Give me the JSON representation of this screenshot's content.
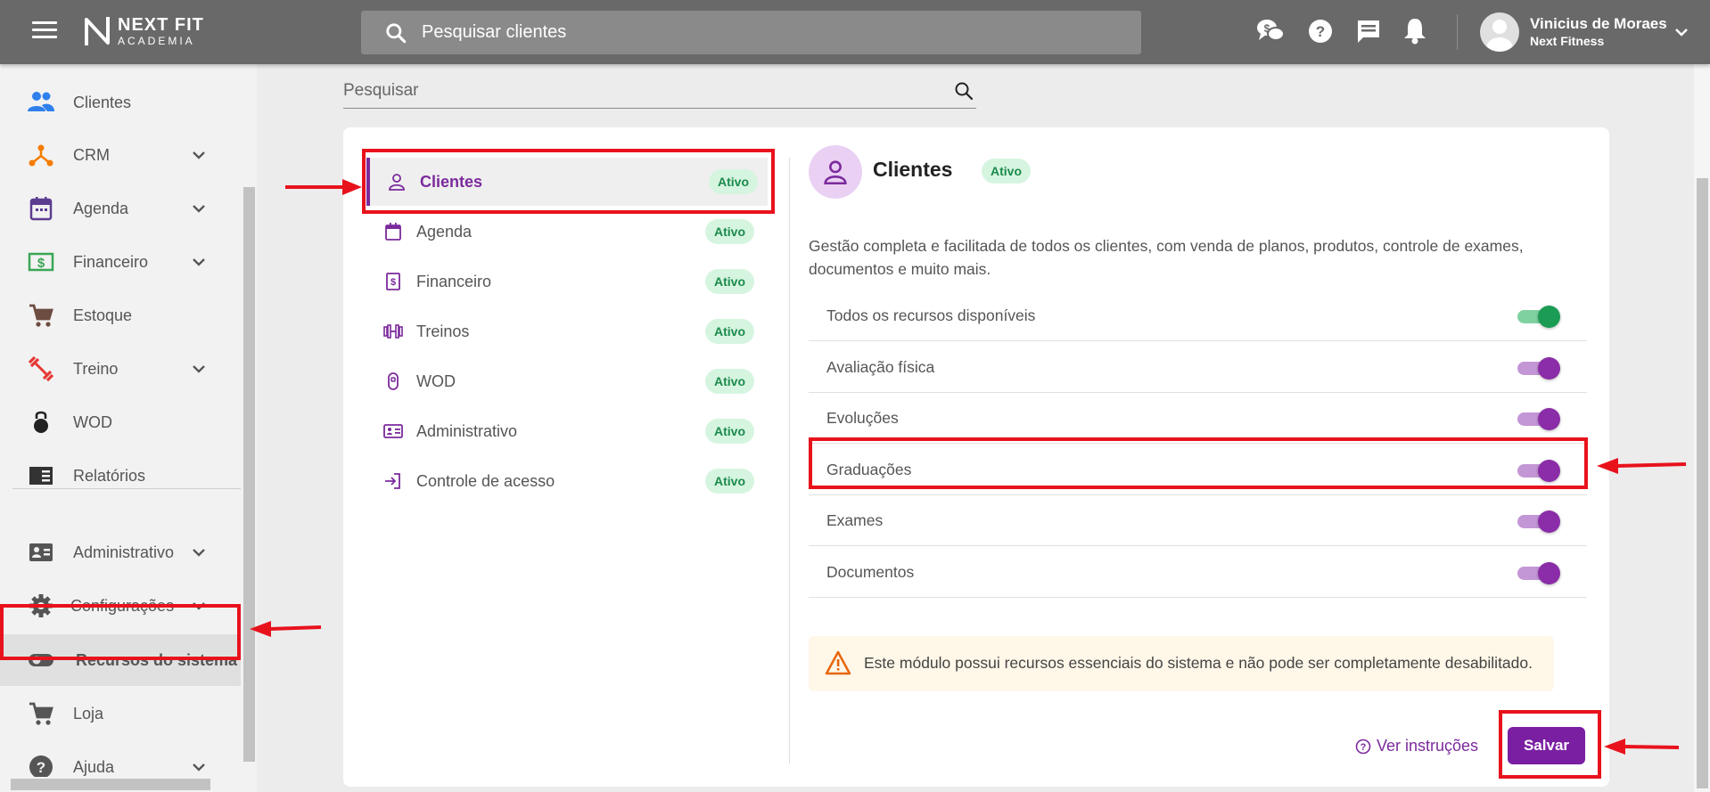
{
  "topbar": {
    "logo_line1": "NEXT FIT",
    "logo_line2": "ACADEMIA",
    "search_placeholder": "Pesquisar clientes",
    "icons": [
      "chat-dollar-icon",
      "help-icon",
      "message-icon",
      "bell-icon"
    ],
    "user_name": "Vinicius de Moraes",
    "user_org": "Next Fitness"
  },
  "sidebar": {
    "items": [
      {
        "label": "Clientes",
        "icon": "people-icon",
        "color": "#2f80ed"
      },
      {
        "label": "CRM",
        "icon": "crm-icon",
        "color": "#f57c00"
      },
      {
        "label": "Agenda",
        "icon": "calendar-icon",
        "color": "#5c3d8f"
      },
      {
        "label": "Financeiro",
        "icon": "money-icon",
        "color": "#3aa655"
      },
      {
        "label": "Estoque",
        "icon": "cart-icon",
        "color": "#6d4c41"
      },
      {
        "label": "Treino",
        "icon": "dumbbell-icon",
        "color": "#e53935"
      },
      {
        "label": "WOD",
        "icon": "kettlebell-icon",
        "color": "#222222"
      },
      {
        "label": "Relatórios",
        "icon": "report-icon",
        "color": "#333333"
      },
      {
        "label": "Administrativo",
        "icon": "id-card-icon",
        "color": "#555555"
      },
      {
        "label": "Configurações",
        "icon": "gear-icon",
        "color": "#555555"
      },
      {
        "label": "Recursos do sistema",
        "icon": "toggle-icon",
        "color": "#555555"
      },
      {
        "label": "Loja",
        "icon": "cart-icon",
        "color": "#555555"
      },
      {
        "label": "Ajuda",
        "icon": "help-icon",
        "color": "#555555"
      }
    ]
  },
  "filter": {
    "placeholder": "Pesquisar"
  },
  "modules": [
    {
      "label": "Clientes",
      "status": "Ativo",
      "icon": "person-icon"
    },
    {
      "label": "Agenda",
      "status": "Ativo",
      "icon": "calendar-icon"
    },
    {
      "label": "Financeiro",
      "status": "Ativo",
      "icon": "money-icon"
    },
    {
      "label": "Treinos",
      "status": "Ativo",
      "icon": "dumbbell-icon"
    },
    {
      "label": "WOD",
      "status": "Ativo",
      "icon": "kettlebell-icon"
    },
    {
      "label": "Administrativo",
      "status": "Ativo",
      "icon": "id-card-icon"
    },
    {
      "label": "Controle de acesso",
      "status": "Ativo",
      "icon": "login-icon"
    }
  ],
  "detail": {
    "title": "Clientes",
    "status": "Ativo",
    "description": "Gestão completa e facilitada de todos os clientes, com venda de planos, produtos, controle de exames, documentos e muito mais.",
    "features": [
      {
        "label": "Todos os recursos disponíveis",
        "on": true,
        "color": "green"
      },
      {
        "label": "Avaliação física",
        "on": true,
        "color": "purple"
      },
      {
        "label": "Evoluções",
        "on": true,
        "color": "purple"
      },
      {
        "label": "Graduações",
        "on": true,
        "color": "purple"
      },
      {
        "label": "Exames",
        "on": true,
        "color": "purple"
      },
      {
        "label": "Documentos",
        "on": true,
        "color": "purple"
      }
    ],
    "alert": "Este módulo possui recursos essenciais do sistema e não pode ser completamente desabilitado.",
    "help_link": "Ver instruções",
    "save_label": "Salvar"
  },
  "colors": {
    "accent": "#7b1fa2",
    "annotation": "#e8121c",
    "badge_bg": "#d6f5e0",
    "badge_text": "#1b8a4c"
  }
}
